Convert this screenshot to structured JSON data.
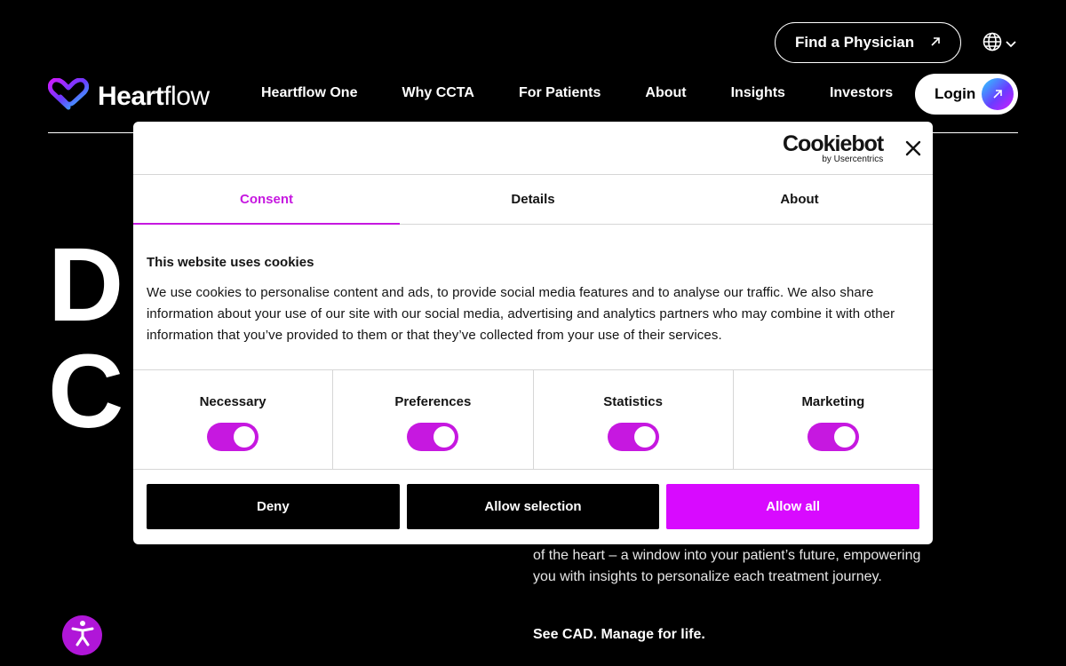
{
  "header": {
    "find_physician": "Find a Physician",
    "logo": {
      "prefix": "Heart",
      "suffix": "flow"
    },
    "nav": [
      "Heartflow One",
      "Why CCTA",
      "For Patients",
      "About",
      "Insights",
      "Investors"
    ],
    "login": "Login"
  },
  "hero": {
    "letter_1": "D",
    "letter_2": "C",
    "paragraph": "of the heart – a window into your patient’s future, empowering you with insights to personalize each treatment journey.",
    "tagline": "See CAD. Manage for life."
  },
  "cookie_dialog": {
    "brand": "Cookiebot",
    "brand_sub": "by Usercentrics",
    "tabs": [
      {
        "label": "Consent",
        "active": true
      },
      {
        "label": "Details",
        "active": false
      },
      {
        "label": "About",
        "active": false
      }
    ],
    "heading": "This website uses cookies",
    "text": "We use cookies to personalise content and ads, to provide social media features and to analyse our traffic. We also share information about your use of our site with our social media, advertising and analytics partners who may combine it with other information that you’ve provided to them or that they’ve collected from your use of their services.",
    "categories": [
      {
        "label": "Necessary",
        "enabled": true
      },
      {
        "label": "Preferences",
        "enabled": true
      },
      {
        "label": "Statistics",
        "enabled": true
      },
      {
        "label": "Marketing",
        "enabled": true
      }
    ],
    "buttons": {
      "deny": "Deny",
      "allow_selection": "Allow selection",
      "allow_all": "Allow all"
    }
  },
  "colors": {
    "accent": "#d80aff",
    "tab_active": "#c618e0",
    "toggle_on": "#c618e0",
    "a11y_button": "#b016d8"
  },
  "icons": {
    "language": "globe-icon",
    "external": "arrow-up-right-icon",
    "accessibility": "accessibility-icon",
    "close": "close-icon"
  }
}
